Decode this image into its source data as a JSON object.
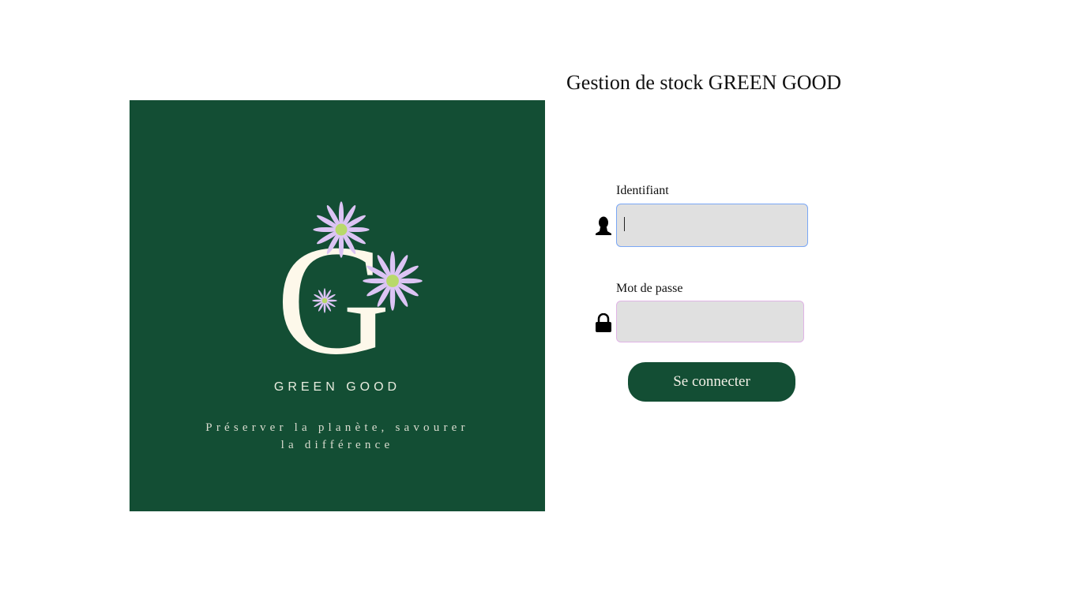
{
  "page": {
    "title": "Gestion de stock GREEN GOOD"
  },
  "logo": {
    "letter": "G",
    "brand": "GREEN GOOD",
    "tagline_line1": "Préserver la planète, savourer",
    "tagline_line2": "la différence"
  },
  "form": {
    "username": {
      "label": "Identifiant",
      "value": "",
      "icon": "user-icon"
    },
    "password": {
      "label": "Mot de passe",
      "value": "",
      "icon": "lock-icon"
    },
    "submit_label": "Se connecter"
  },
  "colors": {
    "brand_green": "#134e34",
    "petal": "#dcc4f4",
    "flower_center": "#b8d96a",
    "cream": "#fdf8ea"
  }
}
